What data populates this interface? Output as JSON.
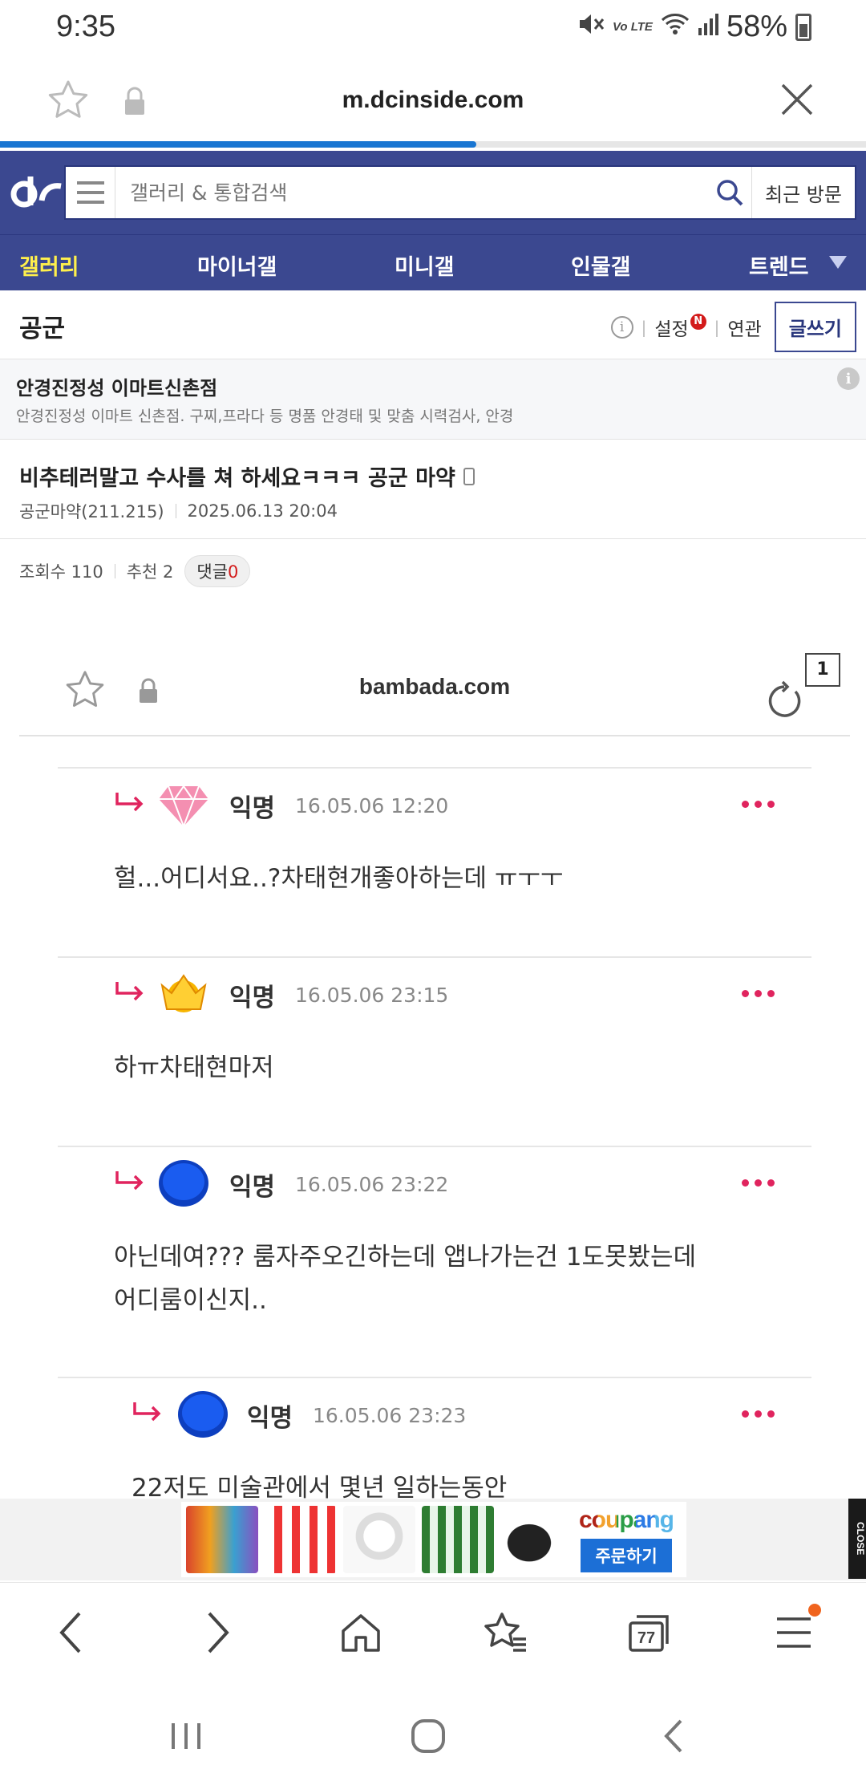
{
  "status_bar": {
    "time": "9:35",
    "battery": "58%",
    "volte": "Vo LTE"
  },
  "browser": {
    "url": "m.dcinside.com",
    "load_progress": 0.55
  },
  "dc": {
    "search_placeholder": "갤러리 & 통합검색",
    "recent_label": "최근 방문",
    "nav_tabs": [
      "갤러리",
      "마이너갤",
      "미니갤",
      "인물갤",
      "트렌드"
    ]
  },
  "gallery": {
    "title": "공군",
    "settings_label": "설정",
    "settings_badge": "N",
    "related_label": "연관",
    "write_label": "글쓰기"
  },
  "ad": {
    "title": "안경진정성 이마트신촌점",
    "desc": "안경진정성 이마트 신촌점. 구찌,프라다 등 명품 안경태 및 맞춤 시력검사, 안경"
  },
  "post": {
    "title": "비추테러말고 수사를 쳐 하세요ㅋㅋㅋ 공군 마약",
    "author": "공군마약(211.215)",
    "datetime": "2025.06.13 20:04",
    "views": "조회수 110",
    "recommend": "추천 2",
    "comment_label": "댓글",
    "comment_count": "0"
  },
  "embedded": {
    "url": "bambada.com",
    "tab_count": "1",
    "comments": [
      {
        "name": "익명",
        "date": "16.05.06 12:20",
        "body": "헐...어디서요..?차태현개좋아하는데 ㅠㅜㅜ",
        "avatar": "pink-diamond-icon"
      },
      {
        "name": "익명",
        "date": "16.05.06 23:15",
        "body": "하ㅠ차태현마저",
        "avatar": "gold-crown-icon"
      },
      {
        "name": "익명",
        "date": "16.05.06 23:22",
        "body": "아닌데여??? 룸자주오긴하는데 앱나가는건 1도못봤는데\n어디룸이신지..",
        "avatar": "blue-circle-icon"
      },
      {
        "name": "익명",
        "date": "16.05.06 23:23",
        "body": "22저도 미술관에서 몇년 일하는동안",
        "avatar": "blue-circle-icon"
      }
    ]
  },
  "coupang_ad": {
    "logo": "coupang",
    "button": "주문하기",
    "close": "CLOSE"
  },
  "toolbar": {
    "tab_count": "77"
  },
  "colors": {
    "dc_blue": "#3b4890",
    "nav_active": "#fff04c",
    "accent_red": "#e0245e",
    "progress": "#1976d2"
  }
}
